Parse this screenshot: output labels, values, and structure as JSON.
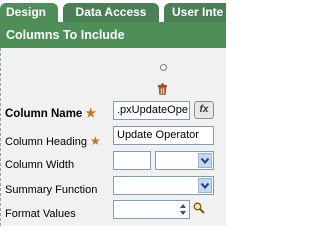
{
  "tabs": [
    {
      "label": "Design",
      "active": true
    },
    {
      "label": "Data Access",
      "active": false
    },
    {
      "label": "User Inte",
      "active": false
    }
  ],
  "section": {
    "title": "Columns To Include"
  },
  "fields": {
    "column_name": {
      "label": "Column Name",
      "value": ".pxUpdateOpe",
      "required": true,
      "formula_button": "fx"
    },
    "column_heading": {
      "label": "Column Heading",
      "value": "Update Operator",
      "required": true
    },
    "column_width": {
      "label": "Column Width",
      "value": "",
      "unit_value": ""
    },
    "summary_function": {
      "label": "Summary Function",
      "value": ""
    },
    "format_values": {
      "label": "Format Values",
      "value": ""
    }
  },
  "colors": {
    "tab_active": "#4f8d59",
    "tab_inactive": "#4b7f56",
    "header": "#4e8f57",
    "required_star": "#c0771b",
    "panel_bg": "#f1f1f1"
  },
  "icons": [
    "delete-icon",
    "formula-icon",
    "lookup-icon",
    "chevron-down-icon",
    "spinner-icon"
  ]
}
